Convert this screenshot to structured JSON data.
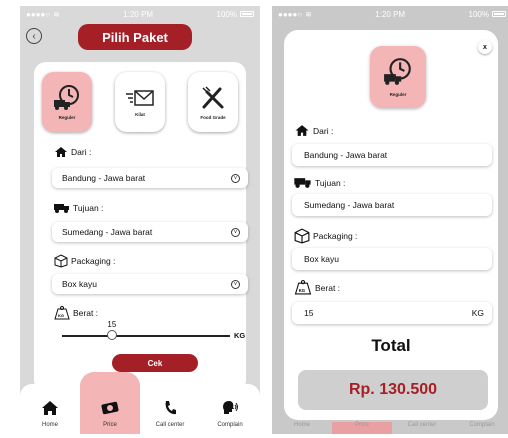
{
  "status": {
    "carrier": "●●●●○",
    "time": "1:20 PM",
    "battery": "100%"
  },
  "screen1": {
    "title": "Pilih Paket",
    "services": [
      {
        "label": "Reguler",
        "icon": "clock-truck-icon",
        "active": true
      },
      {
        "label": "Kilat",
        "icon": "fast-mail-icon",
        "active": false
      },
      {
        "label": "Food Grade",
        "icon": "utensils-icon",
        "active": false
      }
    ],
    "dari": {
      "label": "Dari :",
      "value": "Bandung - Jawa barat"
    },
    "tujuan": {
      "label": "Tujuan :",
      "value": "Sumedang - Jawa barat"
    },
    "packaging": {
      "label": "Packaging :",
      "value": "Box kayu"
    },
    "berat": {
      "label": "Berat :",
      "value": "15",
      "unit": "KG",
      "fraction": 0.3
    },
    "cek_label": "Cek"
  },
  "nav": [
    {
      "label": "Home",
      "icon": "home-icon",
      "active": false
    },
    {
      "label": "Price",
      "icon": "money-icon",
      "active": true
    },
    {
      "label": "Call center",
      "icon": "phone-icon",
      "active": false
    },
    {
      "label": "Complain",
      "icon": "speaking-head-icon",
      "active": false
    }
  ],
  "screen2": {
    "close": "x",
    "service_label": "Reguler",
    "dari": {
      "label": "Dari :",
      "value": "Bandung - Jawa barat"
    },
    "tujuan": {
      "label": "Tujuan :",
      "value": "Sumedang - Jawa barat"
    },
    "packaging": {
      "label": "Packaging :",
      "value": "Box kayu"
    },
    "berat": {
      "label": "Berat :",
      "value": "15",
      "unit": "KG"
    },
    "total_label": "Total",
    "price": "Rp. 130.500"
  },
  "colors": {
    "accent": "#a52026",
    "accent_soft": "#f4b5b7"
  }
}
